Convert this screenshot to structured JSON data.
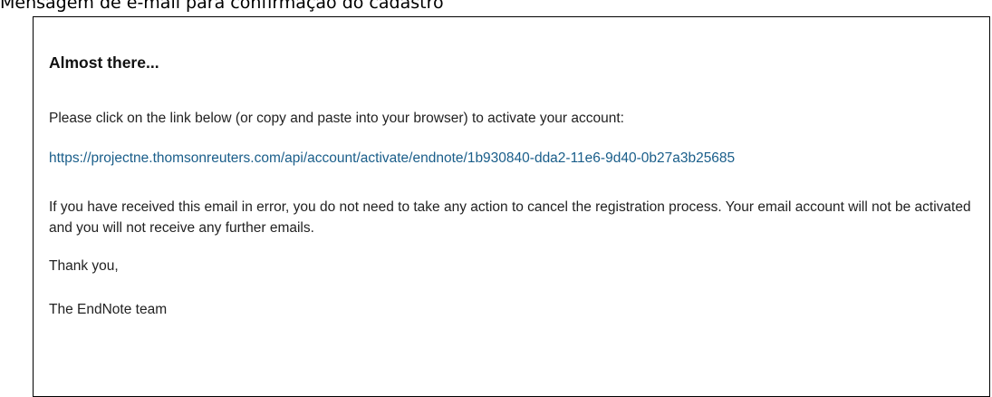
{
  "caption": "Mensagem de e-mail para confirmação do cadastro",
  "email": {
    "heading": "Almost there...",
    "instruction": "Please click on the link below (or copy and paste into your browser) to activate your account:",
    "activation_link": "https://projectne.thomsonreuters.com/api/account/activate/endnote/1b930840-dda2-11e6-9d40-0b27a3b25685",
    "error_notice": "If you have received this email in error, you do not need to take any action to cancel the registration process. Your email account will not be activated and you will not receive any further emails.",
    "closing": "Thank you,",
    "signature": "The EndNote team"
  },
  "colors": {
    "link": "#1a5e8a",
    "text": "#222222",
    "frame_border": "#000000"
  }
}
